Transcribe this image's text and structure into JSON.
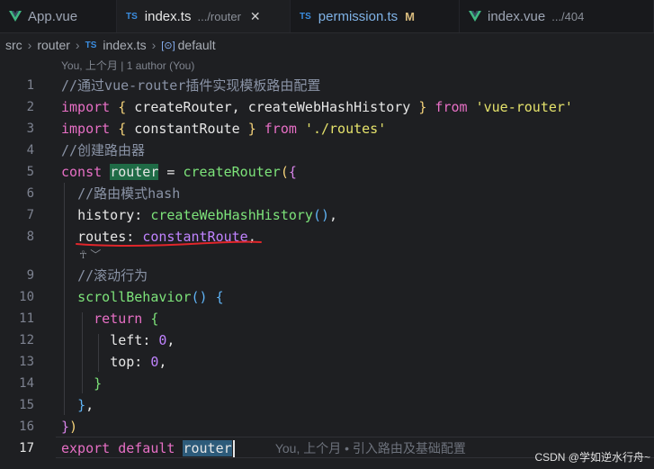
{
  "tabs": [
    {
      "icon": "vue-icon",
      "name": "App.vue",
      "path": "",
      "modified": ""
    },
    {
      "icon": "ts-icon",
      "icon_text": "TS",
      "name": "index.ts",
      "path": ".../router",
      "active": true,
      "close": "✕"
    },
    {
      "icon": "ts-icon",
      "icon_text": "TS",
      "name": "permission.ts",
      "path": "",
      "modified": "M"
    },
    {
      "icon": "vue-icon",
      "name": "index.vue",
      "path": ".../404"
    }
  ],
  "breadcrumb": {
    "parts": [
      "src",
      "router"
    ],
    "file_icon": "TS",
    "file": "index.ts",
    "symbol_icon": "[⊙]",
    "symbol": "default"
  },
  "blame_header": "You, 上个月 | 1 author (You)",
  "ai_hint": "☥ ﹀",
  "line_numbers": [
    "1",
    "2",
    "3",
    "4",
    "5",
    "6",
    "7",
    "8",
    "9",
    "10",
    "11",
    "12",
    "13",
    "14",
    "15",
    "16",
    "17"
  ],
  "code": {
    "l1": "//通过vue-router插件实现模板路由配置",
    "l2_kw1": "import",
    "l2_b": "{",
    "l2_names": " createRouter, createWebHashHistory ",
    "l2_b2": "}",
    "l2_from": "from",
    "l2_str": "'vue-router'",
    "l3_kw1": "import",
    "l3_b": "{",
    "l3_names": " constantRoute ",
    "l3_b2": "}",
    "l3_from": "from",
    "l3_str": "'./routes'",
    "l4": "//创建路由器",
    "l5_kw": "const",
    "l5_var": "router",
    "l5_eq": " = ",
    "l5_fn": "createRouter",
    "l5_p": "(",
    "l5_b": "{",
    "l6": "//路由模式hash",
    "l7_prop": "history",
    "l7_colon": ": ",
    "l7_fn": "createWebHashHistory",
    "l7_p": "()",
    "l7_comma": ",",
    "l8_prop": "routes",
    "l8_colon": ": ",
    "l8_val": "constantRoute",
    "l8_comma": ",",
    "l9": "//滚动行为",
    "l10_fn": "scrollBehavior",
    "l10_p": "()",
    "l10_b": "{",
    "l11_kw": "return",
    "l11_b": "{",
    "l12_prop": "left",
    "l12_colon": ": ",
    "l12_num": "0",
    "l12_comma": ",",
    "l13_prop": "top",
    "l13_colon": ": ",
    "l13_num": "0",
    "l13_comma": ",",
    "l14_b": "}",
    "l15_b": "}",
    "l15_comma": ",",
    "l16_b": "}",
    "l16_p": ")",
    "l17_kw1": "export",
    "l17_kw2": "default",
    "l17_var": "router",
    "l17_blame": "You, 上个月 • 引入路由及基础配置"
  },
  "watermark": "CSDN @学如逆水行舟~",
  "colors": {
    "keyword": "#e76fc5",
    "function": "#7de37a",
    "string": "#e5e26b",
    "comment": "#8a93a6",
    "annotation_underline": "#e0262b"
  }
}
